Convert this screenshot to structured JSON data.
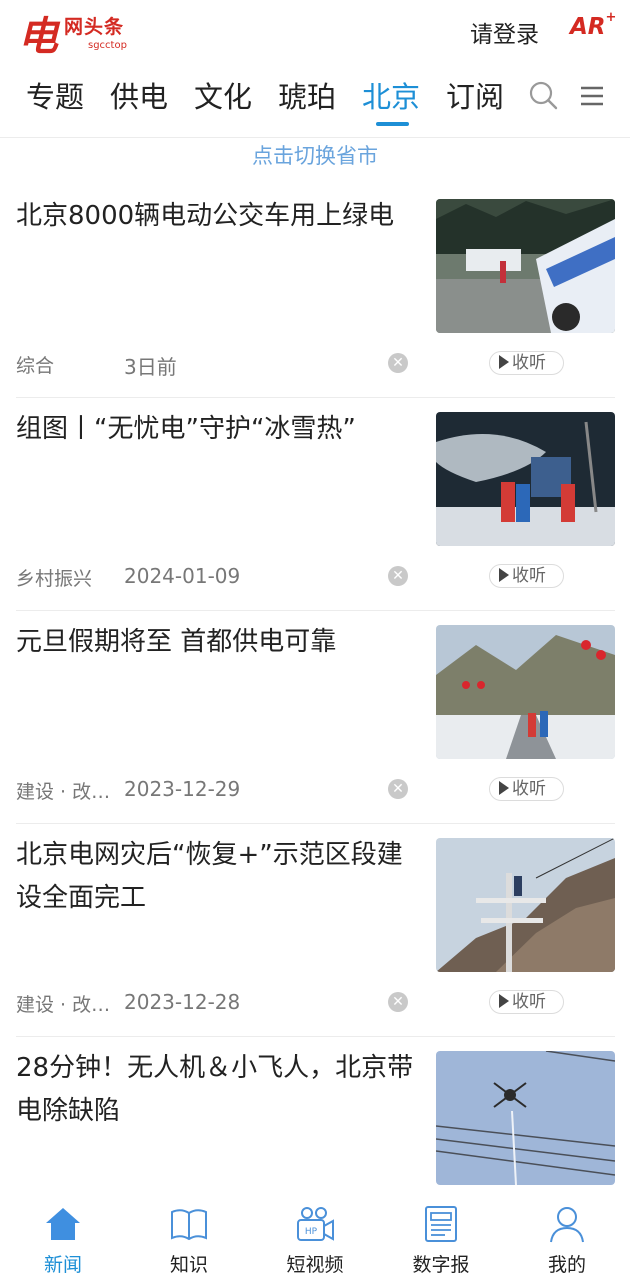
{
  "header": {
    "logo_char": "电",
    "logo_name": "网头条",
    "logo_sub": "sgcctop",
    "login_label": "请登录",
    "ar_label": "AR",
    "ar_plus": "+"
  },
  "tabs": [
    {
      "label": "专题",
      "active": false
    },
    {
      "label": "供电",
      "active": false
    },
    {
      "label": "文化",
      "active": false
    },
    {
      "label": "琥珀",
      "active": false
    },
    {
      "label": "北京",
      "active": true
    },
    {
      "label": "订阅",
      "active": false
    }
  ],
  "tab_icons": [
    "search-icon",
    "menu-icon"
  ],
  "switch_link": "点击切换省市",
  "news": [
    {
      "title": "北京8000辆电动公交车用上绿电",
      "category": "综合",
      "date": "3日前",
      "listen": "收听"
    },
    {
      "title": "组图丨“无忧电”守护“冰雪热”",
      "category": "乡村振兴",
      "date": "2024-01-09",
      "listen": "收听"
    },
    {
      "title": "元旦假期将至 首都供电可靠",
      "category": "建设 · 改…",
      "date": "2023-12-29",
      "listen": "收听"
    },
    {
      "title": "北京电网灾后“恢复+”示范区段建设全面完工",
      "category": "建设 · 改…",
      "date": "2023-12-28",
      "listen": "收听"
    },
    {
      "title": "28分钟！无人机＆小飞人，北京带电除缺陷",
      "category": "",
      "date": "",
      "listen": ""
    }
  ],
  "dismiss_glyph": "✕",
  "bottom_nav": [
    {
      "label": "新闻",
      "icon": "home-icon",
      "active": true
    },
    {
      "label": "知识",
      "icon": "book-icon",
      "active": false
    },
    {
      "label": "短视频",
      "icon": "video-icon",
      "active": false
    },
    {
      "label": "数字报",
      "icon": "newspaper-icon",
      "active": false
    },
    {
      "label": "我的",
      "icon": "user-icon",
      "active": false
    }
  ],
  "colors": {
    "accent": "#1d8fd6",
    "brand": "#d42a22",
    "link": "#6aa4dd"
  }
}
